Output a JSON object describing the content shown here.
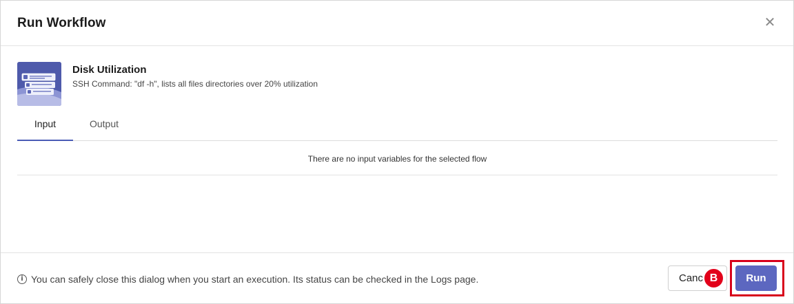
{
  "dialog": {
    "title": "Run Workflow",
    "close_icon": "close-icon"
  },
  "flow": {
    "name": "Disk Utilization",
    "description": "SSH Command: \"df -h\", lists all files directories over 20% utilization",
    "thumbnail_icon": "server-stack-icon"
  },
  "tabs": [
    {
      "label": "Input",
      "active": true
    },
    {
      "label": "Output",
      "active": false
    }
  ],
  "input_panel": {
    "empty_message": "There are no input variables for the selected flow"
  },
  "footer": {
    "info_icon": "info-icon",
    "info_text": "You can safely close this dialog when you start an execution. Its status can be checked in the Logs page.",
    "cancel_label": "Cancel",
    "run_label": "Run",
    "badge_label": "B"
  },
  "colors": {
    "accent": "#5c67c0",
    "highlight": "#d8001b",
    "badge": "#e2001a"
  }
}
